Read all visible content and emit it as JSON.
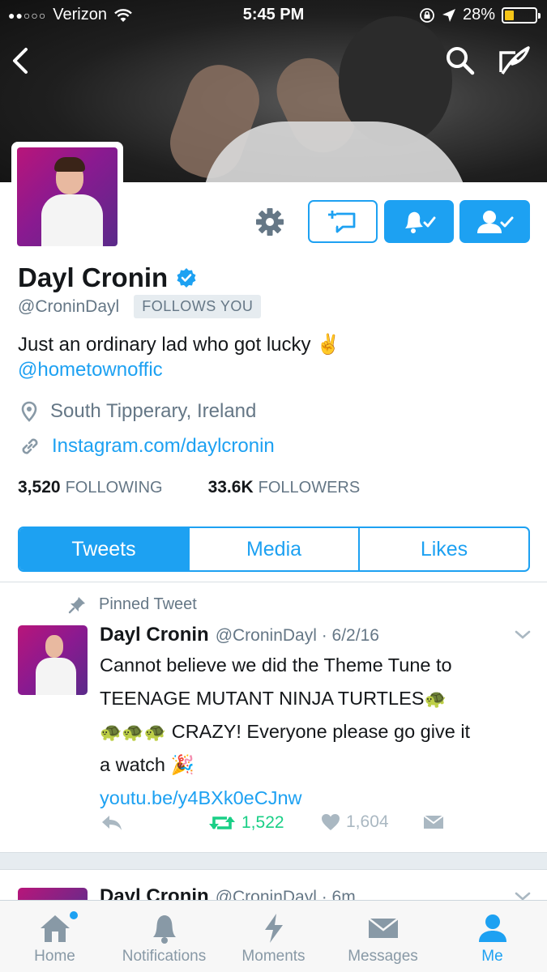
{
  "status_bar": {
    "signal": "●●○○○",
    "carrier": "Verizon",
    "time": "5:45 PM",
    "battery": "28%"
  },
  "profile": {
    "name": "Dayl Cronin",
    "handle": "@CroninDayl",
    "follows_you": "FOLLOWS YOU",
    "bio": "Just an ordinary lad who got lucky ✌️",
    "bio_mention": "@hometownoffic",
    "location": "South Tipperary, Ireland",
    "website": "Instagram.com/daylcronin",
    "following_count": "3,520",
    "following_label": "FOLLOWING",
    "followers_count": "33.6K",
    "followers_label": "FOLLOWERS"
  },
  "tabs": [
    {
      "label": "Tweets"
    },
    {
      "label": "Media"
    },
    {
      "label": "Likes"
    }
  ],
  "pinned_tweet": {
    "pinned_label": "Pinned Tweet",
    "author": "Dayl Cronin",
    "meta": "@CroninDayl · 6/2/16",
    "line1": "Cannot believe we did the Theme Tune to",
    "line2": "TEENAGE MUTANT NINJA TURTLES",
    "line3": "CRAZY! Everyone please go give it",
    "line4": "a watch",
    "turtles": "🐢🐢🐢",
    "turtle": "🐢",
    "party": "🎉",
    "link": "youtu.be/y4BXk0eCJnw",
    "retweets": "1,522",
    "likes": "1,604"
  },
  "next_tweet": {
    "author": "Dayl Cronin",
    "meta": "@CroninDayl · 6m"
  },
  "tabbar": [
    {
      "label": "Home"
    },
    {
      "label": "Notifications"
    },
    {
      "label": "Moments"
    },
    {
      "label": "Messages"
    },
    {
      "label": "Me"
    }
  ],
  "colors": {
    "accent": "#1da1f2",
    "retweet": "#19cf86",
    "muted": "#657786"
  }
}
